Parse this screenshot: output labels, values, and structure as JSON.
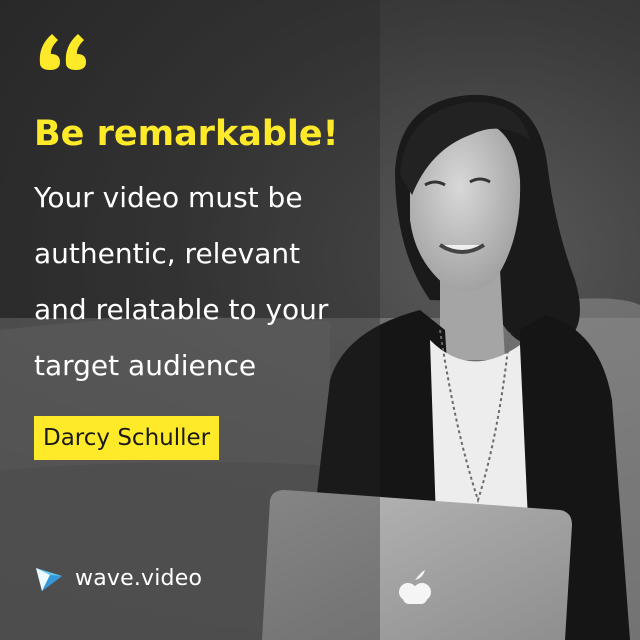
{
  "quote": {
    "icon": "quote-mark-icon",
    "headline": "Be remarkable!",
    "body_lines": [
      "Your video must be",
      "authentic, relevant",
      "and relatable to your",
      "target audience"
    ]
  },
  "author": {
    "name": "Darcy Schuller"
  },
  "brand": {
    "logo_icon": "wave-video-logo-icon",
    "name": "wave.video"
  },
  "colors": {
    "accent": "#ffea2a",
    "text": "#ffffff",
    "background": "#3a3a3a"
  }
}
